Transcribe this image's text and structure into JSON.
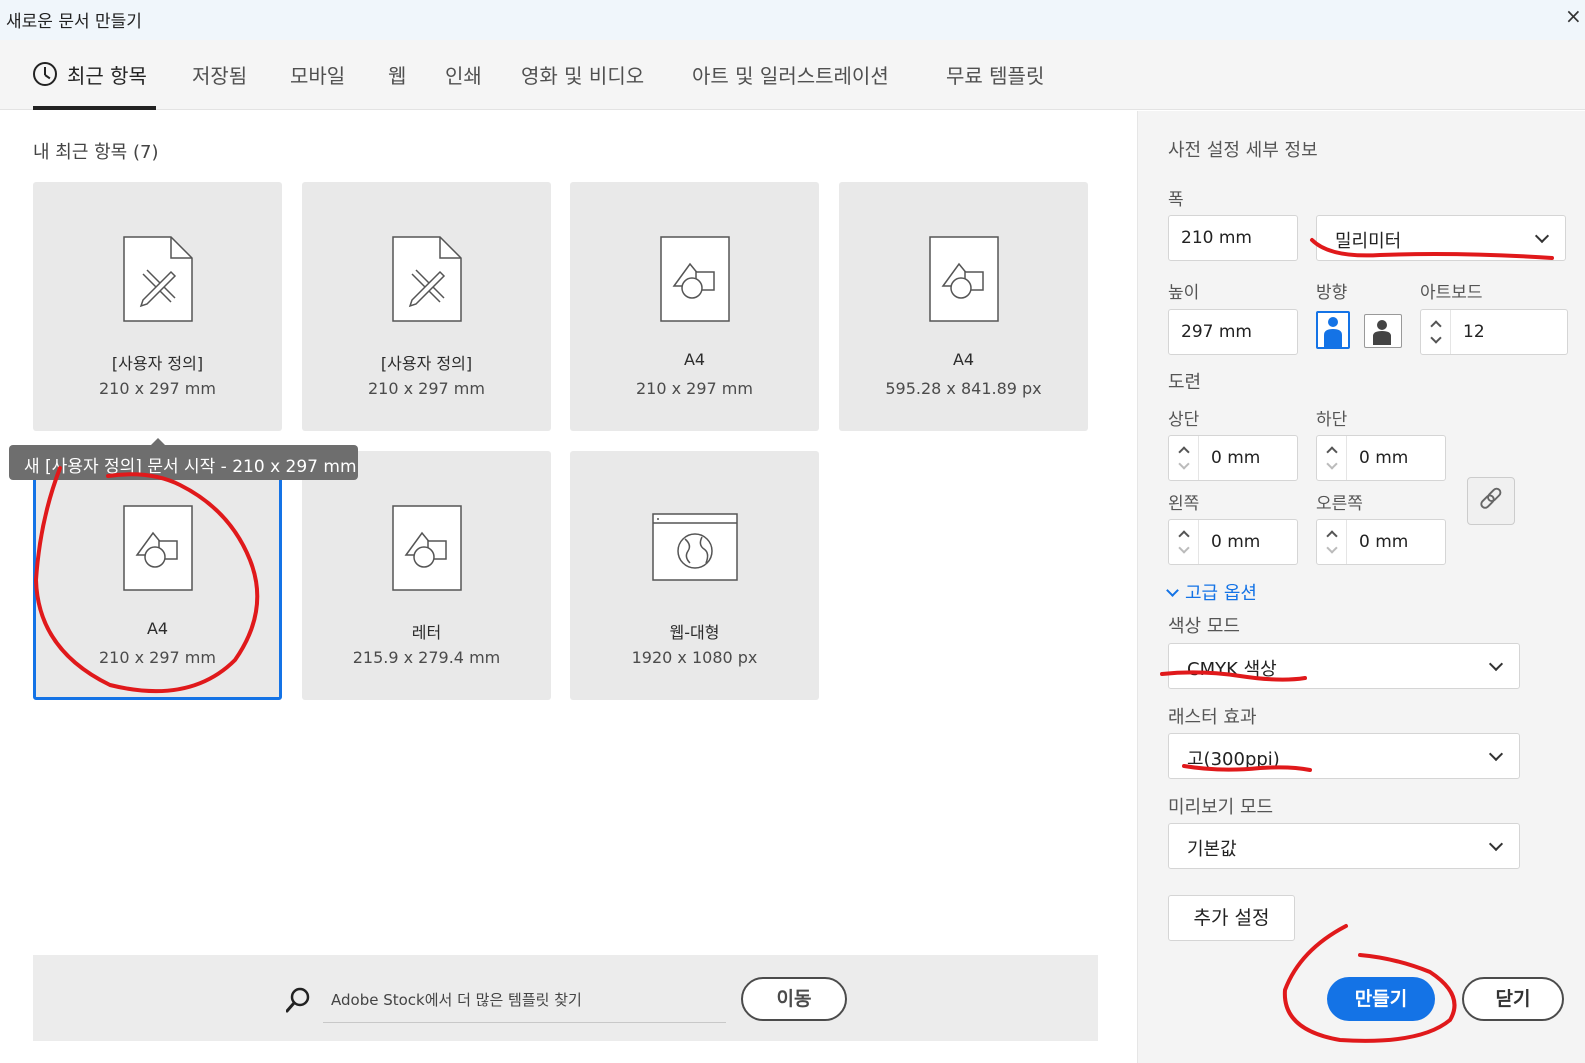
{
  "window": {
    "title": "새로운 문서 만들기",
    "close": "×"
  },
  "tabs": [
    {
      "label": "최근 항목"
    },
    {
      "label": "저장됨"
    },
    {
      "label": "모바일"
    },
    {
      "label": "웹"
    },
    {
      "label": "인쇄"
    },
    {
      "label": "영화 및 비디오"
    },
    {
      "label": "아트 및 일러스트레이션"
    },
    {
      "label": "무료 템플릿"
    }
  ],
  "recent": {
    "title": "내 최근 항목 (7)",
    "items": [
      {
        "name": "[사용자 정의]",
        "dims": "210 x 297 mm",
        "icon": "custom-document-icon"
      },
      {
        "name": "[사용자 정의]",
        "dims": "210 x 297 mm",
        "icon": "custom-document-icon"
      },
      {
        "name": "A4",
        "dims": "210 x 297 mm",
        "icon": "shapes-document-icon"
      },
      {
        "name": "A4",
        "dims": "595.28 x 841.89 px",
        "icon": "shapes-document-icon"
      },
      {
        "name": "A4",
        "dims": "210 x 297 mm",
        "icon": "shapes-document-icon"
      },
      {
        "name": "레터",
        "dims": "215.9 x 279.4 mm",
        "icon": "shapes-document-icon"
      },
      {
        "name": "웹-대형",
        "dims": "1920 x 1080 px",
        "icon": "globe-browser-icon"
      }
    ],
    "tooltip": "새 [사용자 정의] 문서 시작 - 210 x 297 mm"
  },
  "stock": {
    "search_text": "Adobe Stock에서 더 많은 템플릿 찾기",
    "go_label": "이동"
  },
  "preset": {
    "title": "사전 설정 세부 정보",
    "width_label": "폭",
    "width_value": "210 mm",
    "unit": "밀리미터",
    "height_label": "높이",
    "height_value": "297 mm",
    "orientation_label": "방향",
    "artboard_label": "아트보드",
    "artboard_value": "12",
    "bleed_label": "도련",
    "top_label": "상단",
    "top_value": "0 mm",
    "bottom_label": "하단",
    "bottom_value": "0 mm",
    "left_label": "왼쪽",
    "left_value": "0 mm",
    "right_label": "오른쪽",
    "right_value": "0 mm",
    "advanced_label": "고급 옵션",
    "color_mode_label": "색상 모드",
    "color_mode_value": "CMYK 색상",
    "raster_label": "래스터 효과",
    "raster_value": "고(300ppi)",
    "preview_label": "미리보기 모드",
    "preview_value": "기본값",
    "more_settings": "추가 설정",
    "create": "만들기",
    "close": "닫기"
  },
  "colors": {
    "accent": "#1473e6",
    "annotation": "#e0191b"
  }
}
